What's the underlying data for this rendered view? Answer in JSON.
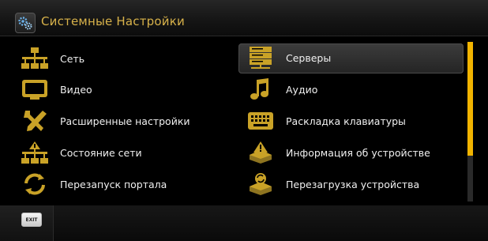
{
  "header": {
    "title": "Системные Настройки",
    "icon": "gear-icon"
  },
  "left_items": [
    {
      "name": "network",
      "label": "Сеть",
      "icon": "network-icon"
    },
    {
      "name": "video",
      "label": "Видео",
      "icon": "monitor-icon"
    },
    {
      "name": "advanced",
      "label": "Расширенные настройки",
      "icon": "wrench-icon"
    },
    {
      "name": "network-status",
      "label": "Состояние сети",
      "icon": "network-info-icon"
    },
    {
      "name": "restart-portal",
      "label": "Перезапуск портала",
      "icon": "refresh-icon"
    }
  ],
  "right_items": [
    {
      "name": "servers",
      "label": "Серверы",
      "icon": "server-icon",
      "selected": true
    },
    {
      "name": "audio",
      "label": "Аудио",
      "icon": "music-note-icon"
    },
    {
      "name": "keyboard-layout",
      "label": "Раскладка клавиатуры",
      "icon": "keyboard-icon"
    },
    {
      "name": "device-info",
      "label": "Информация об устройстве",
      "icon": "device-info-icon"
    },
    {
      "name": "device-reboot",
      "label": "Перезагрузка устройства",
      "icon": "device-reboot-icon"
    }
  ],
  "footer": {
    "exit_label": "EXIT"
  },
  "colors": {
    "accent": "#f2b400",
    "title": "#d8b24a",
    "icon": "#c9a227"
  },
  "scroll": {
    "position_fraction": 0.0
  }
}
